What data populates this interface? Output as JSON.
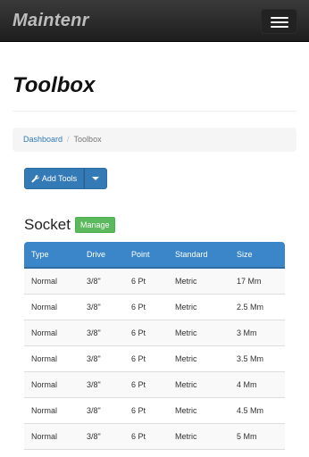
{
  "navbar": {
    "brand": "Maintenr"
  },
  "page": {
    "title": "Toolbox"
  },
  "breadcrumb": {
    "items": [
      "Dashboard",
      "Toolbox"
    ]
  },
  "actions": {
    "add_tools_label": "Add Tools"
  },
  "section": {
    "title": "Socket",
    "manage_label": "Manage",
    "columns": [
      "Type",
      "Drive",
      "Point",
      "Standard",
      "Size"
    ],
    "rows": [
      [
        "Normal",
        "3/8\"",
        "6 Pt",
        "Metric",
        "17 Mm"
      ],
      [
        "Normal",
        "3/8\"",
        "6 Pt",
        "Metric",
        "2.5 Mm"
      ],
      [
        "Normal",
        "3/8\"",
        "6 Pt",
        "Metric",
        "3 Mm"
      ],
      [
        "Normal",
        "3/8\"",
        "6 Pt",
        "Metric",
        "3.5 Mm"
      ],
      [
        "Normal",
        "3/8\"",
        "6 Pt",
        "Metric",
        "4 Mm"
      ],
      [
        "Normal",
        "3/8\"",
        "6 Pt",
        "Metric",
        "4.5 Mm"
      ],
      [
        "Normal",
        "3/8\"",
        "6 Pt",
        "Metric",
        "5 Mm"
      ]
    ]
  },
  "colors": {
    "navbar": "#2a2a2a",
    "primary": "#337ab7",
    "table_header": "#3a86c9",
    "success": "#5cb85c"
  }
}
